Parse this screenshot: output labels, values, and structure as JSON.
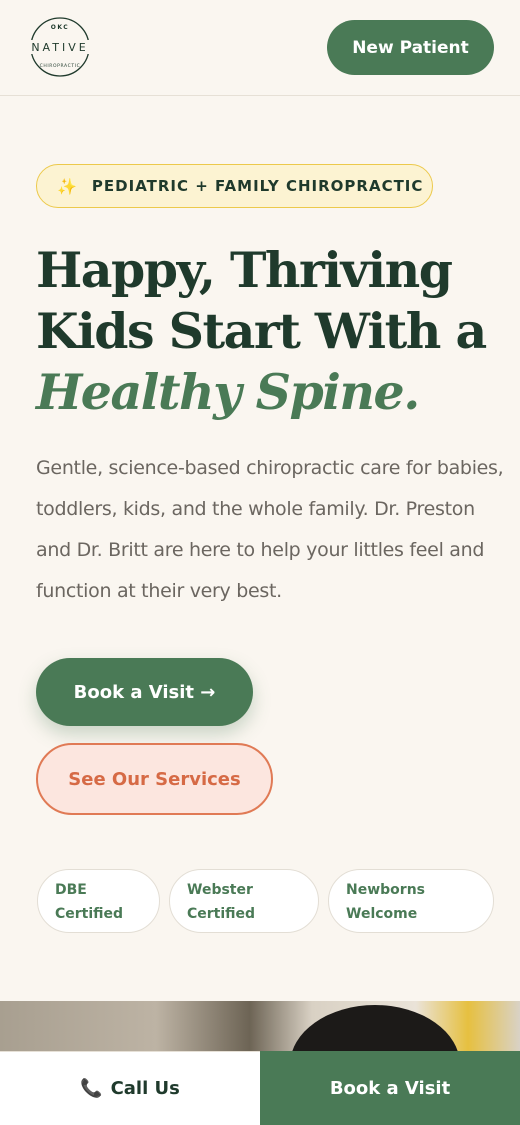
{
  "header": {
    "logo": {
      "top_text": "OKC",
      "name": "NATIVE",
      "bottom_text": "CHIROPRACTIC"
    },
    "new_patient_label": "New Patient"
  },
  "hero": {
    "badge_icon": "sparkle-icon",
    "badge_text": "PEDIATRIC + FAMILY CHIROPRACTIC",
    "headline_line1": "Happy, Thriving",
    "headline_line2": "Kids Start With a",
    "headline_accent": "Healthy Spine.",
    "lead": "Gentle, science-based chiropractic care for babies, toddlers, kids, and the whole family. Dr. Preston and Dr. Britt are here to help your littles feel and function at their very best.",
    "book_label": "Book a Visit →",
    "services_label": "See Our Services"
  },
  "trust_pills": [
    {
      "line1": "DBE",
      "line2": "Certified"
    },
    {
      "line1": "Webster",
      "line2": "Certified"
    },
    {
      "line1": "Newborns",
      "line2": "Welcome"
    }
  ],
  "bottom_bar": {
    "call_icon": "phone-icon",
    "call_label": "Call Us",
    "book_label": "Book a Visit"
  },
  "colors": {
    "background": "#faf6f0",
    "primary_green": "#4a7a56",
    "dark_green": "#1f3a2c",
    "coral": "#e07a55",
    "badge_yellow": "#ecc94b"
  }
}
